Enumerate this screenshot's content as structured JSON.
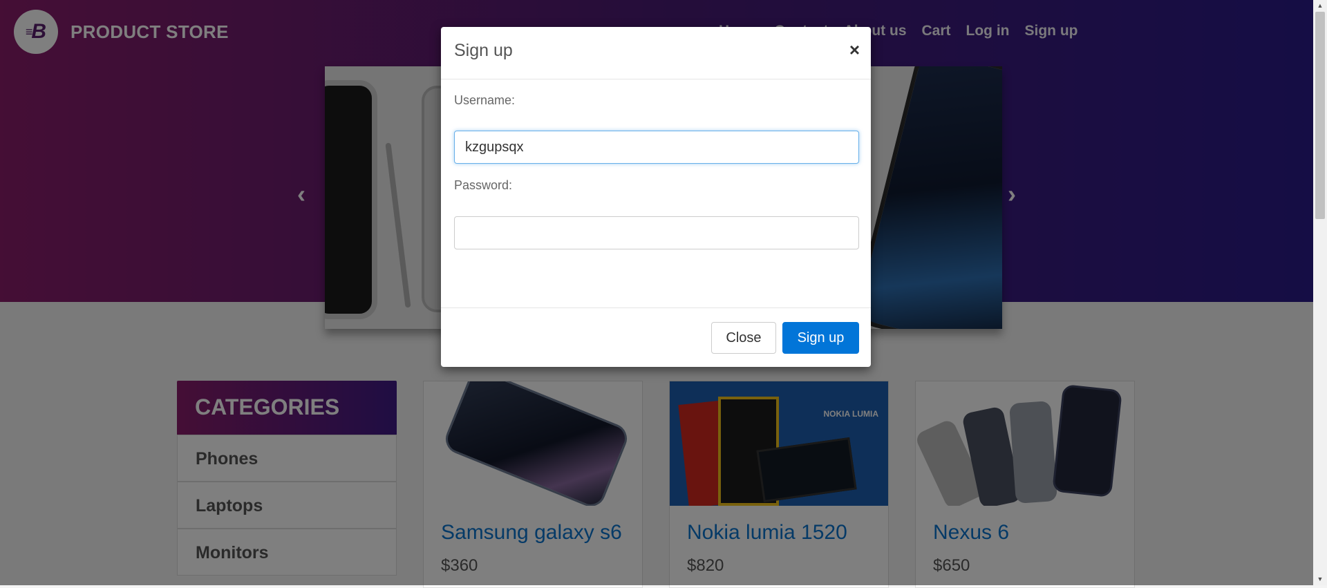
{
  "brand": {
    "name": "PRODUCT STORE",
    "logo_letter": "B"
  },
  "nav": {
    "items": [
      "Home",
      "Contact",
      "About us",
      "Cart",
      "Log in",
      "Sign up"
    ]
  },
  "carousel": {
    "prev": "‹",
    "next": "›"
  },
  "categories": {
    "title": "CATEGORIES",
    "items": [
      "Phones",
      "Laptops",
      "Monitors"
    ]
  },
  "products": [
    {
      "name": "Samsung galaxy s6",
      "price": "$360"
    },
    {
      "name": "Nokia lumia 1520",
      "price": "$820",
      "badge": "NOKIA LUMIA"
    },
    {
      "name": "Nexus 6",
      "price": "$650"
    }
  ],
  "modal": {
    "title": "Sign up",
    "close_symbol": "×",
    "username_label": "Username:",
    "username_value": "kzgupsqx",
    "password_label": "Password:",
    "password_value": "",
    "close_button": "Close",
    "signup_button": "Sign up"
  },
  "colors": {
    "primary": "#0275d8",
    "link": "#0a74cf",
    "gradient_start": "#8a1c6b",
    "gradient_end": "#2a1a8a"
  }
}
